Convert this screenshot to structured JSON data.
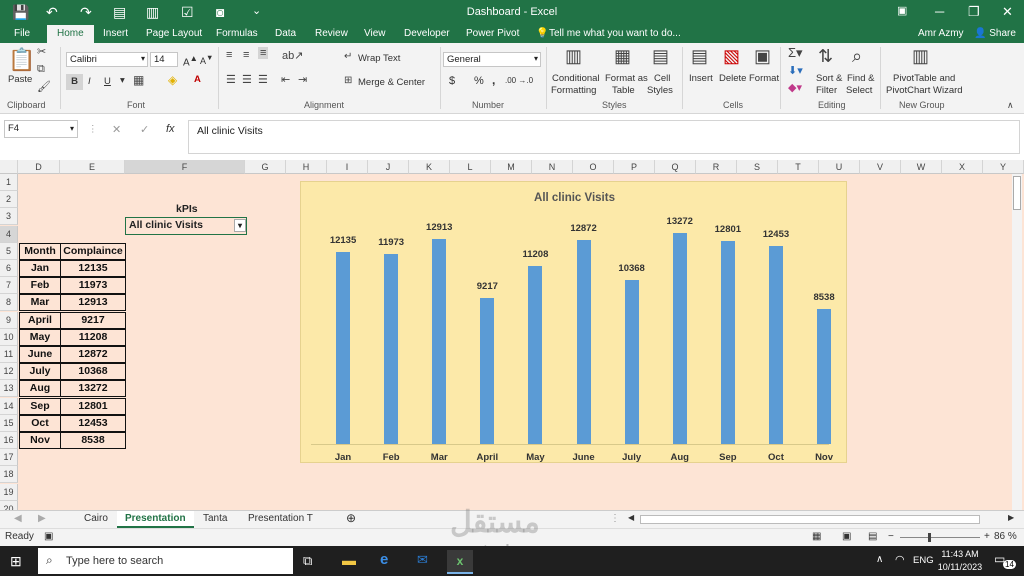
{
  "window": {
    "title": "Dashboard - Excel",
    "user": "Amr Azmy"
  },
  "menu": {
    "tabs": [
      "File",
      "Home",
      "Insert",
      "Page Layout",
      "Formulas",
      "Data",
      "Review",
      "View",
      "Developer",
      "Power Pivot"
    ],
    "tell_me": "Tell me what you want to do...",
    "share": "Share"
  },
  "ribbon": {
    "paste": "Paste",
    "clipboard": "Clipboard",
    "font_name": "Calibri",
    "font_size": "14",
    "font_group": "Font",
    "bold": "B",
    "italic": "I",
    "underline": "U",
    "wrap_text": "Wrap Text",
    "merge_center": "Merge & Center",
    "alignment": "Alignment",
    "number_format": "General",
    "currency": "$",
    "percent": "%",
    "comma": ",",
    "inc_dec": ".00 →.0",
    "number": "Number",
    "conditional_1": "Conditional",
    "conditional_2": "Formatting",
    "format_table_1": "Format as",
    "format_table_2": "Table",
    "cell_styles_1": "Cell",
    "cell_styles_2": "Styles",
    "styles": "Styles",
    "insert": "Insert",
    "delete": "Delete",
    "format": "Format",
    "cells": "Cells",
    "sort_1": "Sort &",
    "sort_2": "Filter",
    "find_1": "Find &",
    "find_2": "Select",
    "editing": "Editing",
    "pivot_1": "PivotTable and",
    "pivot_2": "PivotChart Wizard",
    "new_group": "New Group"
  },
  "formula_bar": {
    "name_box": "F4",
    "fx": "fx",
    "value": "All clinic Visits"
  },
  "columns": [
    "D",
    "E",
    "F",
    "G",
    "H",
    "I",
    "J",
    "K",
    "L",
    "M",
    "N",
    "O",
    "P",
    "Q",
    "R",
    "S",
    "T",
    "U",
    "V",
    "W",
    "X",
    "Y"
  ],
  "rows": [
    "1",
    "2",
    "3",
    "4",
    "5",
    "6",
    "7",
    "8",
    "9",
    "10",
    "11",
    "12",
    "13",
    "14",
    "15",
    "16",
    "17",
    "18",
    "19",
    "20"
  ],
  "kpis": {
    "label": "kPIs",
    "selected": "All clinic Visits"
  },
  "table": {
    "headers": [
      "Month",
      "Complaince"
    ],
    "rows": [
      [
        "Jan",
        "12135"
      ],
      [
        "Feb",
        "11973"
      ],
      [
        "Mar",
        "12913"
      ],
      [
        "April",
        "9217"
      ],
      [
        "May",
        "11208"
      ],
      [
        "June",
        "12872"
      ],
      [
        "July",
        "10368"
      ],
      [
        "Aug",
        "13272"
      ],
      [
        "Sep",
        "12801"
      ],
      [
        "Oct",
        "12453"
      ],
      [
        "Nov",
        "8538"
      ]
    ]
  },
  "chart_data": {
    "type": "bar",
    "title": "All clinic Visits",
    "categories": [
      "Jan",
      "Feb",
      "Mar",
      "April",
      "May",
      "June",
      "July",
      "Aug",
      "Sep",
      "Oct",
      "Nov"
    ],
    "values": [
      12135,
      11973,
      12913,
      9217,
      11208,
      12872,
      10368,
      13272,
      12801,
      12453,
      8538
    ],
    "xlabel": "",
    "ylabel": "",
    "ylim": [
      0,
      14500
    ],
    "grid": false,
    "legend": "none",
    "bar_color": "#5b9bd5",
    "background": "#fce9a9"
  },
  "sheets": {
    "tabs": [
      "Cairo",
      "Presentation",
      "Tanta",
      "Presentation T"
    ],
    "active": "Presentation"
  },
  "status": {
    "ready": "Ready",
    "zoom": "86 %"
  },
  "taskbar": {
    "search": "Type here to search",
    "lang": "ENG",
    "time": "11:43 AM",
    "date": "10/11/2023",
    "badge": "14"
  },
  "watermark": {
    "arabic": "مستقل",
    "latin": "mostaql.com"
  },
  "colors": {
    "excel_green": "#217346",
    "sheet_bg": "#fde4d5",
    "chart_bg": "#fce9a9"
  }
}
